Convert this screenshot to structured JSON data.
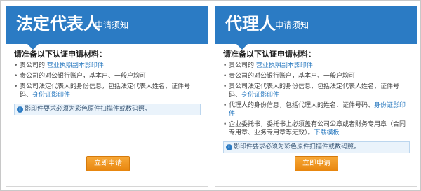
{
  "left_panel": {
    "title": "法定代表人",
    "subtitle": "申请须知",
    "section_title": "请准备以下认证申请材料：",
    "items": [
      {
        "prefix": "贵公司的",
        "link": "营业执照副本影印件",
        "suffix": ""
      },
      {
        "prefix": "贵公司的对公银行账户，基本户、一般户均可",
        "link": "",
        "suffix": ""
      },
      {
        "prefix": "贵公司法定代表人的身份信息，包括法定代表人姓名、证件号码、",
        "link": "身份证影印件",
        "suffix": ""
      }
    ],
    "notice": "影印件要求必须为彩色原件扫描件或数码照。",
    "button": "立即申请"
  },
  "right_panel": {
    "title": "代理人",
    "subtitle": "申请须知",
    "section_title": "请准备以下认证申请材料：",
    "items": [
      {
        "prefix": "贵公司的",
        "link": "营业执照副本影印件",
        "suffix": ""
      },
      {
        "prefix": "贵公司的对公银行账户，基本户、一般户均可",
        "link": "",
        "suffix": ""
      },
      {
        "prefix": "贵公司法定代表人的身份信息，包括法定代表人姓名、证件号码、",
        "link": "身份证影印件",
        "suffix": ""
      },
      {
        "prefix": "代理人的身份信息，包括代理人的姓名、证件号码、",
        "link": "身份证影印件",
        "suffix": ""
      },
      {
        "prefix": "企业委托书，委托书上必须盖有公司公章或者财务专用章（合同专用章、业务专用章等无效）。",
        "link": "下载模板",
        "suffix": ""
      }
    ],
    "notice": "影印件要求必须为彩色原件扫描件或数码照。",
    "button": "立即申请"
  }
}
